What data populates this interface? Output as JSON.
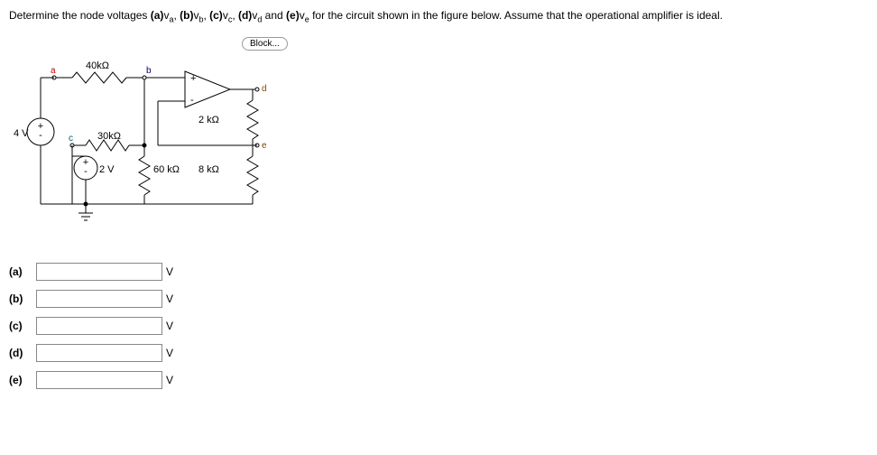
{
  "problem": {
    "prefix": "Determine the node voltages ",
    "parts": [
      {
        "tag": "(a)",
        "var": "v",
        "sub": "a"
      },
      {
        "tag": "(b)",
        "var": "v",
        "sub": "b"
      },
      {
        "tag": "(c)",
        "var": "v",
        "sub": "c"
      },
      {
        "tag": "(d)",
        "var": "v",
        "sub": "d"
      },
      {
        "tag": "(e)",
        "var": "v",
        "sub": "e"
      }
    ],
    "joiner": ", ",
    "lastjoiner": " and ",
    "suffix": " for the circuit shown in the figure below. Assume that the operational amplifier is ideal."
  },
  "block_button": "Block...",
  "circuit": {
    "nodes": {
      "a": "a",
      "b": "b",
      "c": "c",
      "d": "d",
      "e": "e"
    },
    "vsrc1": "4 V",
    "vsrc2": "2 V",
    "r40k": "40kΩ",
    "r30k": "30kΩ",
    "r60k": "60 kΩ",
    "r2k": "2  kΩ",
    "r8k": "8  kΩ",
    "opamp_plus": "+",
    "opamp_minus": "-"
  },
  "answers": [
    {
      "label": "(a)",
      "unit": "V"
    },
    {
      "label": "(b)",
      "unit": "V"
    },
    {
      "label": "(c)",
      "unit": "V"
    },
    {
      "label": "(d)",
      "unit": "V"
    },
    {
      "label": "(e)",
      "unit": "V"
    }
  ]
}
